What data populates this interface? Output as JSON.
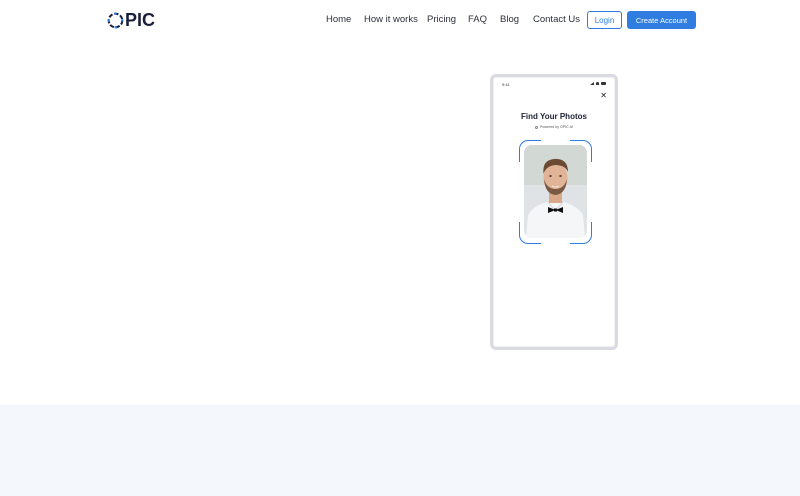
{
  "brand": {
    "logo_text": "PIC",
    "accent": "#2f7de1"
  },
  "nav": {
    "items": [
      {
        "label": "Home"
      },
      {
        "label": "How it works"
      },
      {
        "label": "Pricing"
      },
      {
        "label": "FAQ"
      },
      {
        "label": "Blog"
      },
      {
        "label": "Contact Us"
      }
    ],
    "login_label": "Login",
    "create_label": "Create Account"
  },
  "phone": {
    "time": "9:41",
    "title": "Find Your Photos",
    "subtitle": "Powered by OPIC AI",
    "icons": [
      "signal-icon",
      "wifi-icon",
      "battery-icon",
      "close-icon"
    ]
  }
}
